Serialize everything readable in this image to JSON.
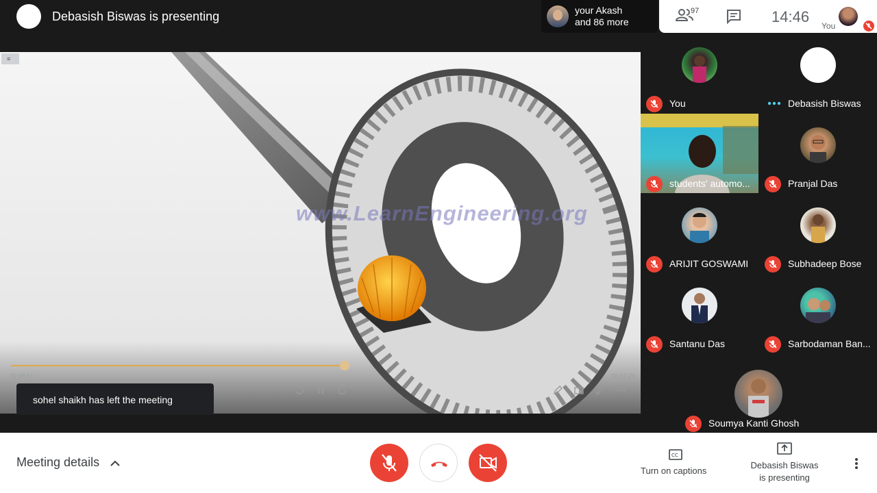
{
  "header": {
    "presenter_title": "Debasish Biswas is presenting"
  },
  "joined_chip": {
    "line1": "your Akash",
    "line2": "and 86 more"
  },
  "top_panel": {
    "people_count": "97",
    "clock": "14:46",
    "self_label": "You"
  },
  "presentation": {
    "watermark": "www.LearnEngineering.org",
    "time_start": "00:45:51",
    "time_end": "00:52:26",
    "progress": 0.53
  },
  "toast": {
    "message": "sohel shaikh has left the meeting"
  },
  "participants": [
    {
      "name": "You",
      "muted": true
    },
    {
      "name": "Debasish Biswas",
      "muted": false,
      "speaking_dots": true
    },
    {
      "name": "students' automo...",
      "muted": true,
      "video": true
    },
    {
      "name": "Pranjal Das",
      "muted": true
    },
    {
      "name": "ARIJIT GOSWAMI",
      "muted": true
    },
    {
      "name": "Subhadeep Bose",
      "muted": true
    },
    {
      "name": "Santanu Das",
      "muted": true
    },
    {
      "name": "Sarbodaman Ban...",
      "muted": true
    },
    {
      "name": "Soumya Kanti Ghosh",
      "muted": true
    }
  ],
  "bottom_bar": {
    "meeting_details": "Meeting details",
    "captions_label": "Turn on captions",
    "present_line1": "Debasish Biswas",
    "present_line2": "is presenting"
  },
  "colors": {
    "mute_red": "#ea4335",
    "accent_orange": "#f5a623",
    "bar_bg": "#ffffff",
    "dark_bg": "#1a1a1a"
  },
  "icons": [
    "people-icon",
    "chat-icon",
    "mic-off-icon",
    "call-end-icon",
    "camera-off-icon",
    "captions-icon",
    "present-icon",
    "more-vert-icon",
    "chevron-up-icon"
  ]
}
